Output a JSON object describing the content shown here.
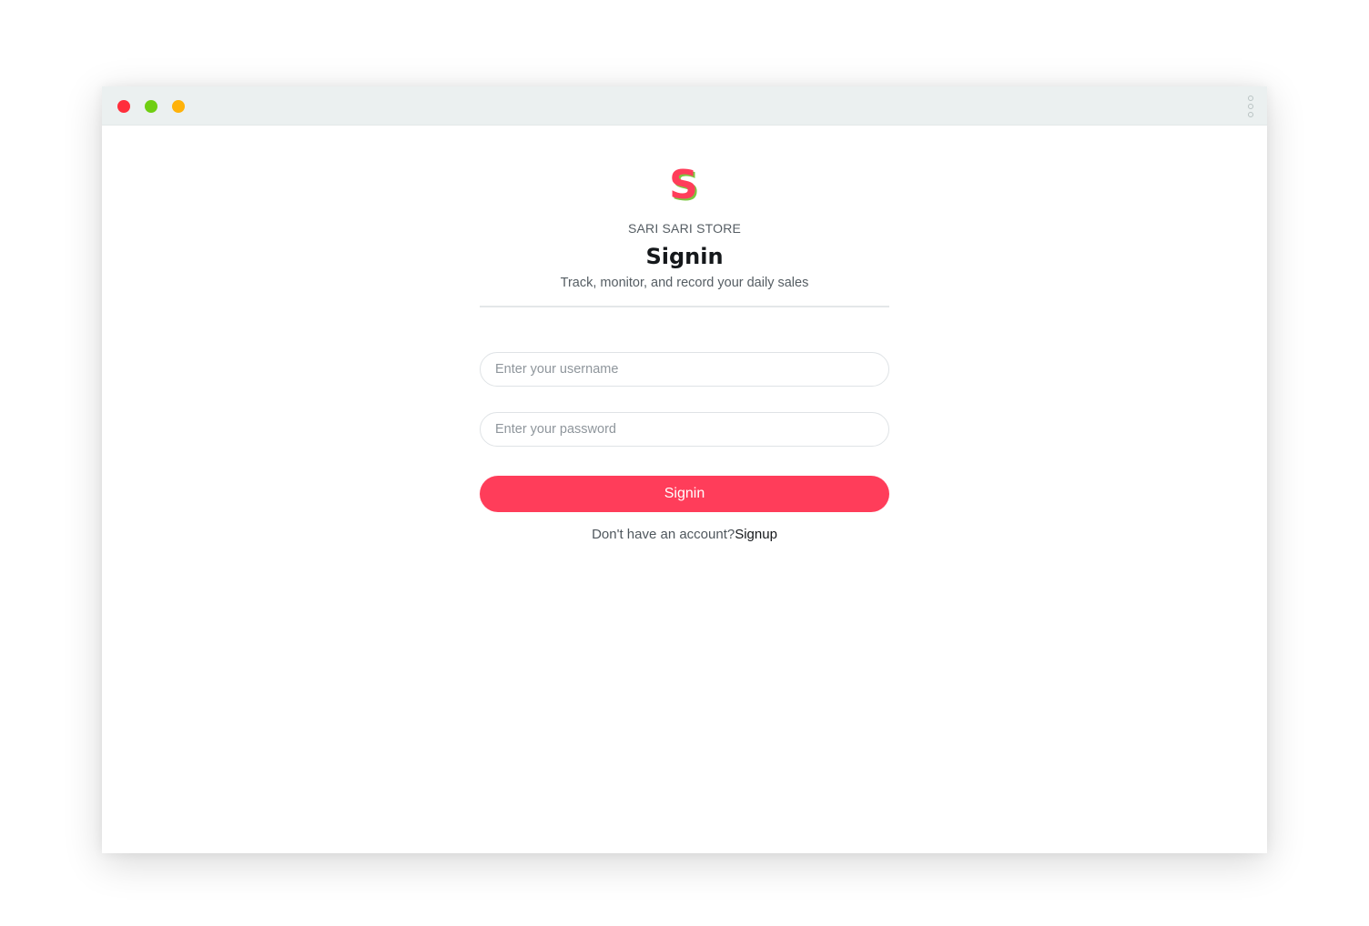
{
  "window": {
    "controls": [
      {
        "name": "close",
        "color": "#ff2e3b"
      },
      {
        "name": "minimize",
        "color": "#6fce12"
      },
      {
        "name": "maximize",
        "color": "#ffb20a"
      }
    ],
    "menu_icon": "vertical-ellipsis-icon"
  },
  "brand": {
    "logo_icon": "letter-s-logo",
    "logo_letter": "S",
    "logo_color": "#ff3d5a",
    "logo_accent_color": "#7cc63f",
    "store_name": "SARI SARI STORE"
  },
  "form": {
    "title": "Signin",
    "subtitle": "Track, monitor, and record your daily sales",
    "username_placeholder": "Enter your username",
    "password_placeholder": "Enter your password",
    "submit_label": "Signin",
    "submit_color": "#ff3d5a",
    "signup_prompt": "Don't have an account?",
    "signup_link": "Signup"
  }
}
